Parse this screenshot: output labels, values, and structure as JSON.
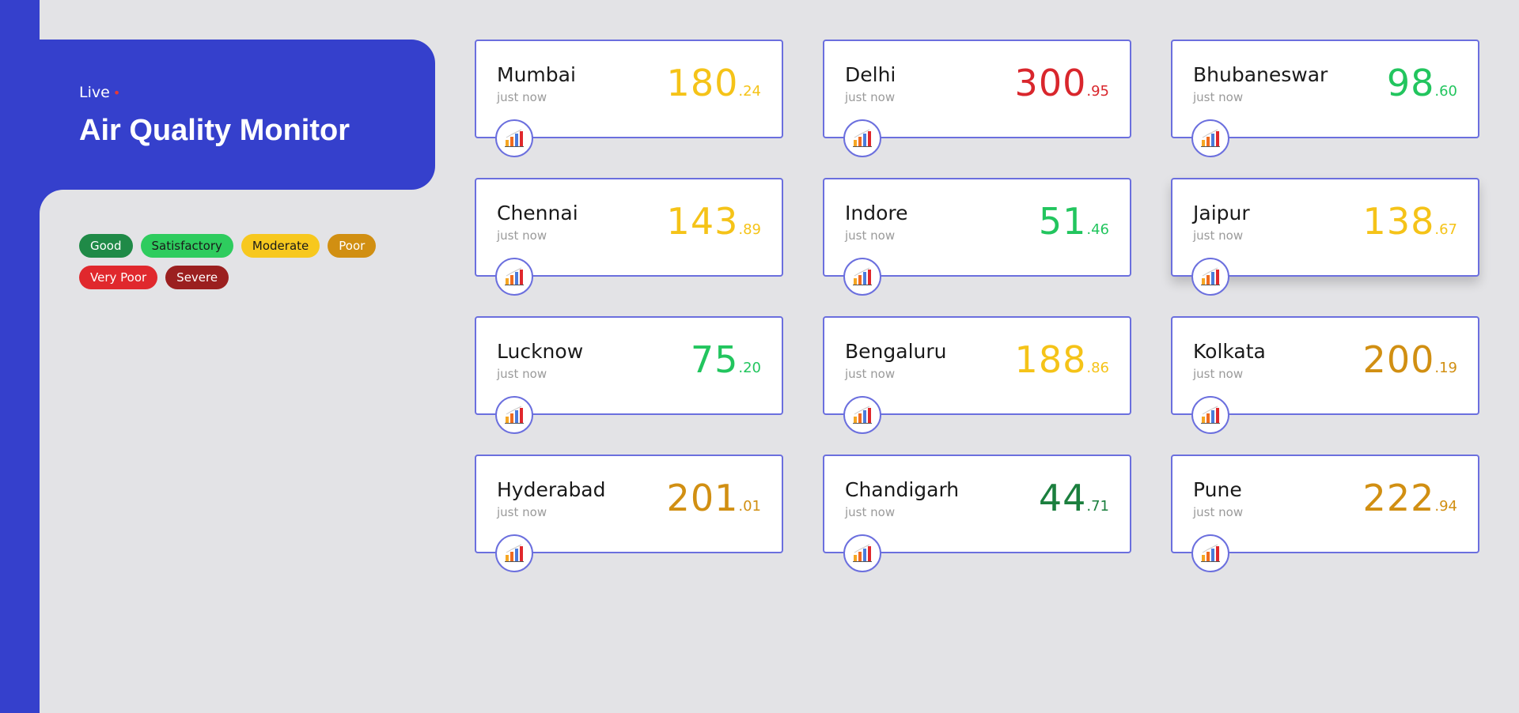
{
  "header": {
    "live_label": "Live",
    "live_dot": "•",
    "title": "Air Quality Monitor"
  },
  "legend": [
    {
      "label": "Good",
      "bg": "#1f8a47",
      "fg": "#ffffff"
    },
    {
      "label": "Satisfactory",
      "bg": "#2ecc5e",
      "fg": "#1a1a1a"
    },
    {
      "label": "Moderate",
      "bg": "#f7c81e",
      "fg": "#1a1a1a"
    },
    {
      "label": "Poor",
      "bg": "#d18f12",
      "fg": "#ffffff"
    },
    {
      "label": "Very Poor",
      "bg": "#e0282d",
      "fg": "#ffffff"
    },
    {
      "label": "Severe",
      "bg": "#9b1f1f",
      "fg": "#ffffff"
    }
  ],
  "cities": [
    {
      "name": "Mumbai",
      "updated": "just now",
      "aqi_int": "180",
      "aqi_dec": ".24",
      "color": "#f5c318"
    },
    {
      "name": "Delhi",
      "updated": "just now",
      "aqi_int": "300",
      "aqi_dec": ".95",
      "color": "#d9262c"
    },
    {
      "name": "Bhubaneswar",
      "updated": "just now",
      "aqi_int": "98",
      "aqi_dec": ".60",
      "color": "#22c55e"
    },
    {
      "name": "Chennai",
      "updated": "just now",
      "aqi_int": "143",
      "aqi_dec": ".89",
      "color": "#f5c318"
    },
    {
      "name": "Indore",
      "updated": "just now",
      "aqi_int": "51",
      "aqi_dec": ".46",
      "color": "#22c55e"
    },
    {
      "name": "Jaipur",
      "updated": "just now",
      "aqi_int": "138",
      "aqi_dec": ".67",
      "color": "#f5c318"
    },
    {
      "name": "Lucknow",
      "updated": "just now",
      "aqi_int": "75",
      "aqi_dec": ".20",
      "color": "#22c55e"
    },
    {
      "name": "Bengaluru",
      "updated": "just now",
      "aqi_int": "188",
      "aqi_dec": ".86",
      "color": "#f5c318"
    },
    {
      "name": "Kolkata",
      "updated": "just now",
      "aqi_int": "200",
      "aqi_dec": ".19",
      "color": "#d18f12"
    },
    {
      "name": "Hyderabad",
      "updated": "just now",
      "aqi_int": "201",
      "aqi_dec": ".01",
      "color": "#d18f12"
    },
    {
      "name": "Chandigarh",
      "updated": "just now",
      "aqi_int": "44",
      "aqi_dec": ".71",
      "color": "#1b7f3e"
    },
    {
      "name": "Pune",
      "updated": "just now",
      "aqi_int": "222",
      "aqi_dec": ".94",
      "color": "#d18f12"
    }
  ],
  "icons": {
    "chart_button": "bar-chart-icon"
  },
  "colors": {
    "accent": "#3540cc",
    "card_border": "#6b6fde",
    "background": "#e3e3e6"
  }
}
